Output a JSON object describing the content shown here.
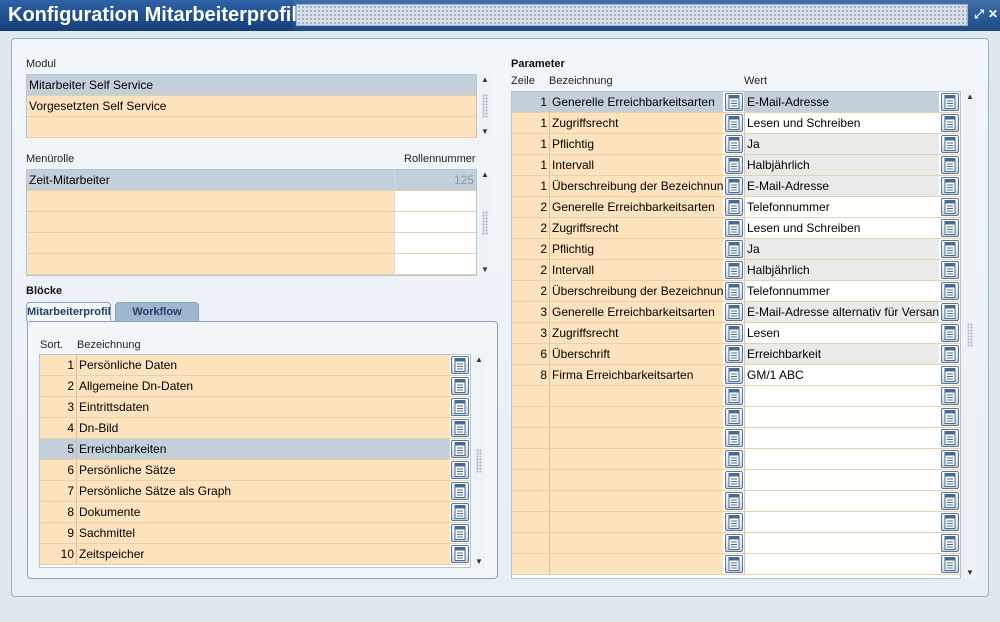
{
  "window": {
    "title": "Konfiguration Mitarbeiterprofil",
    "restore_glyph": "⤢",
    "close_glyph": "✕"
  },
  "modul": {
    "label": "Modul",
    "items": [
      "Mitarbeiter Self Service",
      "Vorgesetzten Self Service",
      ""
    ]
  },
  "menurolle": {
    "label": "Menürolle",
    "number_label": "Rollennummer",
    "rows": [
      {
        "name": "Zeit-Mitarbeiter",
        "number": "125"
      },
      {
        "name": "",
        "number": ""
      },
      {
        "name": "",
        "number": ""
      },
      {
        "name": "",
        "number": ""
      },
      {
        "name": "",
        "number": ""
      }
    ]
  },
  "bloecke": {
    "label": "Blöcke",
    "tabs": [
      "Mitarbeiterprofil",
      "Workflow"
    ],
    "col_sort": "Sort.",
    "col_name": "Bezeichnung",
    "rows": [
      {
        "sort": "1",
        "name": "Persönliche Daten"
      },
      {
        "sort": "2",
        "name": "Allgemeine Dn-Daten"
      },
      {
        "sort": "3",
        "name": "Eintrittsdaten"
      },
      {
        "sort": "4",
        "name": "Dn-Bild"
      },
      {
        "sort": "5",
        "name": "Erreichbarkeiten"
      },
      {
        "sort": "6",
        "name": "Persönliche Sätze"
      },
      {
        "sort": "7",
        "name": "Persönliche Sätze als Graph"
      },
      {
        "sort": "8",
        "name": "Dokumente"
      },
      {
        "sort": "9",
        "name": "Sachmittel"
      },
      {
        "sort": "10",
        "name": "Zeitspeicher"
      }
    ]
  },
  "parameter": {
    "label": "Parameter",
    "col_zeile": "Zeile",
    "col_name": "Bezeichnung",
    "col_wert": "Wert",
    "rows": [
      {
        "zeile": "1",
        "name": "Generelle Erreichbarkeitsarten",
        "wert": "E-Mail-Adresse"
      },
      {
        "zeile": "1",
        "name": "Zugriffsrecht",
        "wert": "Lesen und Schreiben"
      },
      {
        "zeile": "1",
        "name": "Pflichtig",
        "wert": "Ja"
      },
      {
        "zeile": "1",
        "name": "Intervall",
        "wert": "Halbjährlich"
      },
      {
        "zeile": "1",
        "name": "Überschreibung der Bezeichnung",
        "wert": "E-Mail-Adresse"
      },
      {
        "zeile": "2",
        "name": "Generelle Erreichbarkeitsarten",
        "wert": "Telefonnummer"
      },
      {
        "zeile": "2",
        "name": "Zugriffsrecht",
        "wert": "Lesen und Schreiben"
      },
      {
        "zeile": "2",
        "name": "Pflichtig",
        "wert": "Ja"
      },
      {
        "zeile": "2",
        "name": "Intervall",
        "wert": "Halbjährlich"
      },
      {
        "zeile": "2",
        "name": "Überschreibung der Bezeichnung",
        "wert": "Telefonnummer"
      },
      {
        "zeile": "3",
        "name": "Generelle Erreichbarkeitsarten",
        "wert": "E-Mail-Adresse alternativ für Versand"
      },
      {
        "zeile": "3",
        "name": "Zugriffsrecht",
        "wert": "Lesen"
      },
      {
        "zeile": "6",
        "name": "Überschrift",
        "wert": "Erreichbarkeit"
      },
      {
        "zeile": "8",
        "name": "Firma Erreichbarkeitsarten",
        "wert": "GM/1 ABC"
      },
      {
        "zeile": "",
        "name": "",
        "wert": ""
      },
      {
        "zeile": "",
        "name": "",
        "wert": ""
      },
      {
        "zeile": "",
        "name": "",
        "wert": ""
      },
      {
        "zeile": "",
        "name": "",
        "wert": ""
      },
      {
        "zeile": "",
        "name": "",
        "wert": ""
      },
      {
        "zeile": "",
        "name": "",
        "wert": ""
      },
      {
        "zeile": "",
        "name": "",
        "wert": ""
      },
      {
        "zeile": "",
        "name": "",
        "wert": ""
      },
      {
        "zeile": "",
        "name": "",
        "wert": ""
      }
    ]
  },
  "colors": {
    "peach": "#fde3bd",
    "selected": "#c4cfdc",
    "title_bar": "#1e4a86"
  },
  "icons": {
    "lov_button": "list-of-values-icon",
    "scroll_up": "▲",
    "scroll_down": "▼"
  }
}
